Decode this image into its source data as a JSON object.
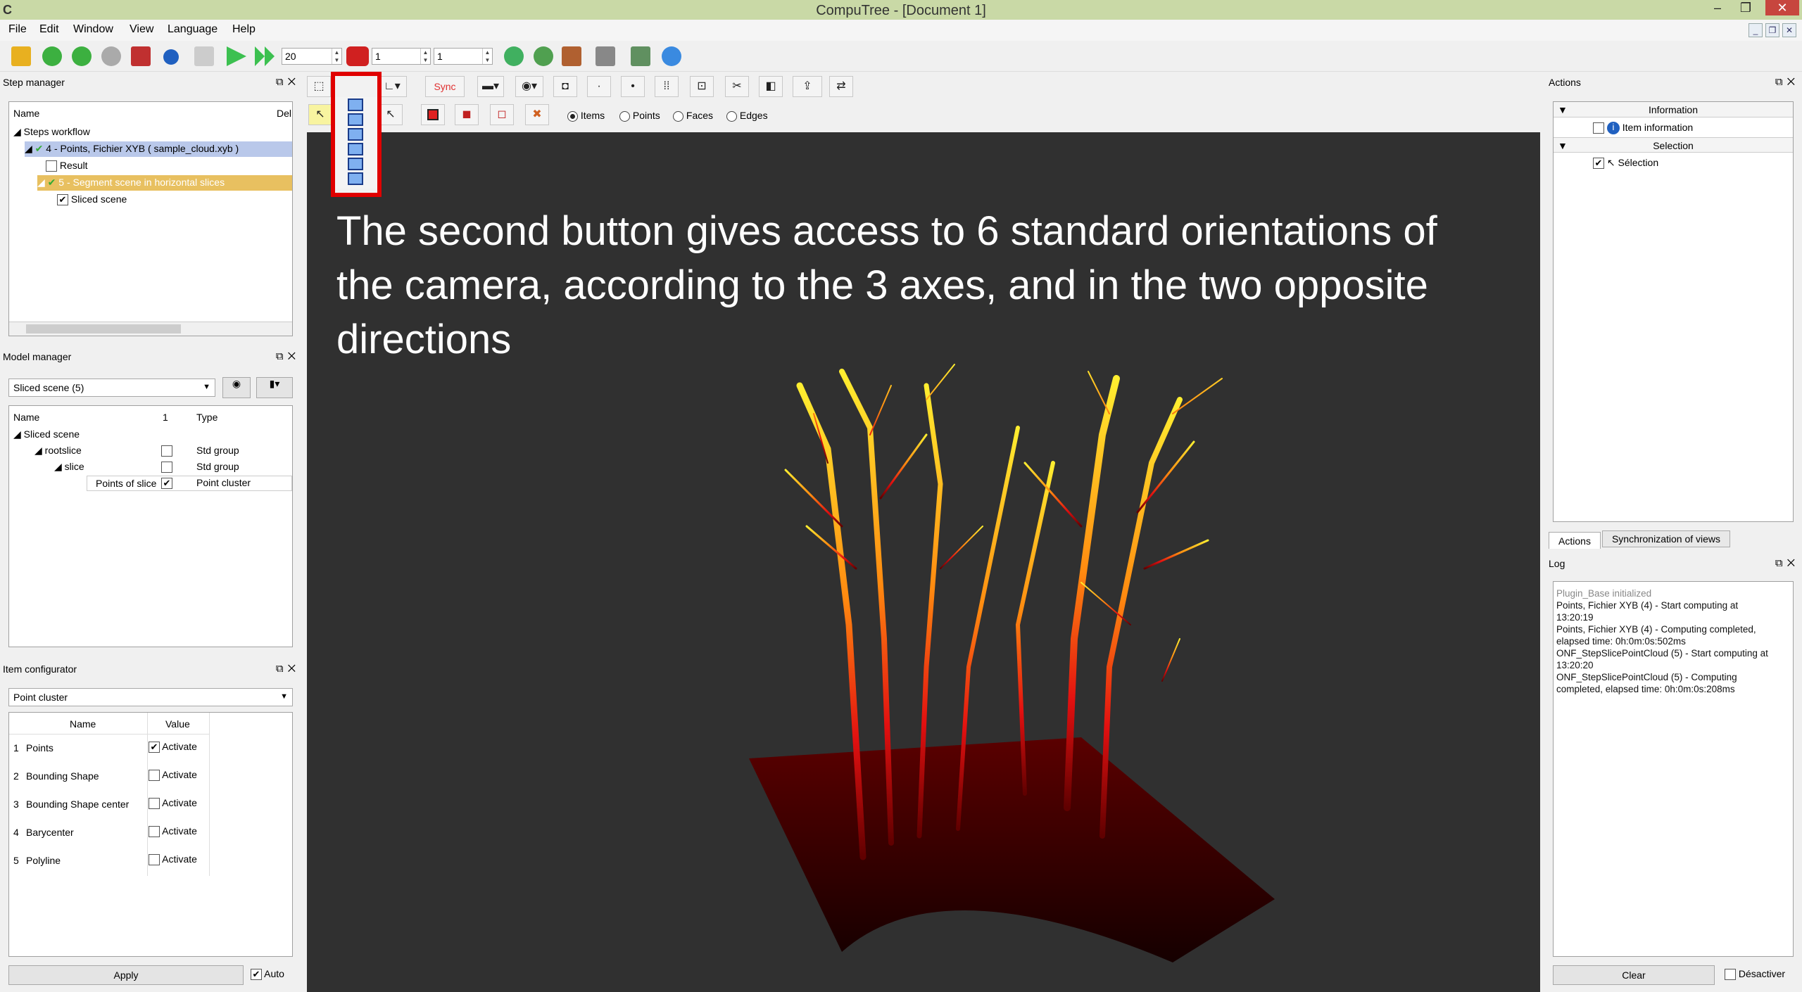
{
  "window": {
    "title": "CompuTree - [Document 1]",
    "app_icon": "C"
  },
  "menus": [
    "File",
    "Edit",
    "Window",
    "View",
    "Language",
    "Help"
  ],
  "toolbar": {
    "spin1": "20",
    "spin2": "1",
    "spin3": "1"
  },
  "step_manager": {
    "title": "Step manager",
    "col_name": "Name",
    "col_debug": "Del",
    "rows": [
      "Steps workflow",
      "4 - Points, Fichier XYB ( sample_cloud.xyb )",
      "Result",
      "5 - Segment scene in horizontal slices",
      "Sliced scene"
    ]
  },
  "model_manager": {
    "title": "Model manager",
    "combo": "Sliced scene (5)",
    "col_name": "Name",
    "col_1": "1",
    "col_type": "Type",
    "rows": [
      {
        "name": "Sliced scene",
        "type": ""
      },
      {
        "name": "rootslice",
        "type": "Std group"
      },
      {
        "name": "slice",
        "type": "Std group"
      },
      {
        "name": "Points of slice",
        "type": "Point cluster"
      }
    ]
  },
  "item_configurator": {
    "title": "Item configurator",
    "combo": "Point cluster",
    "col_name": "Name",
    "col_value": "Value",
    "rows": [
      {
        "num": "1",
        "name": "Points",
        "value": "Activate",
        "checked": true
      },
      {
        "num": "2",
        "name": "Bounding Shape",
        "value": "Activate",
        "checked": false
      },
      {
        "num": "3",
        "name": "Bounding Shape center",
        "value": "Activate",
        "checked": false
      },
      {
        "num": "4",
        "name": "Barycenter",
        "value": "Activate",
        "checked": false
      },
      {
        "num": "5",
        "name": "Polyline",
        "value": "Activate",
        "checked": false
      }
    ],
    "apply": "Apply",
    "auto": "Auto"
  },
  "view": {
    "sync": "Sync",
    "radios": [
      "Items",
      "Points",
      "Faces",
      "Edges"
    ],
    "annotation": "The second button gives access to 6 standard orientations of the camera, according to the 3 axes, and in the two opposite directions"
  },
  "actions": {
    "title": "Actions",
    "section_info": "Information",
    "item_info": "Item information",
    "section_sel": "Selection",
    "item_sel": "Sélection",
    "tab_actions": "Actions",
    "tab_sync": "Synchronization of views"
  },
  "log": {
    "title": "Log",
    "first_line": "Plugin_Base initialized",
    "lines": [
      "Points, Fichier XYB (4) - Start computing at",
      "13:20:19",
      "Points, Fichier XYB (4) - Computing completed,",
      "elapsed time: 0h:0m:0s:502ms",
      "ONF_StepSlicePointCloud (5) - Start computing at",
      "13:20:20",
      "ONF_StepSlicePointCloud (5) - Computing",
      "completed, elapsed time: 0h:0m:0s:208ms"
    ],
    "clear": "Clear",
    "disable": "Désactiver"
  },
  "colors": {
    "titlebar": "#c9d9a6",
    "view_bg": "#303030",
    "highlight": "#e00000",
    "selected_row": "#b9c8ea",
    "running_row": "#e8c060"
  }
}
